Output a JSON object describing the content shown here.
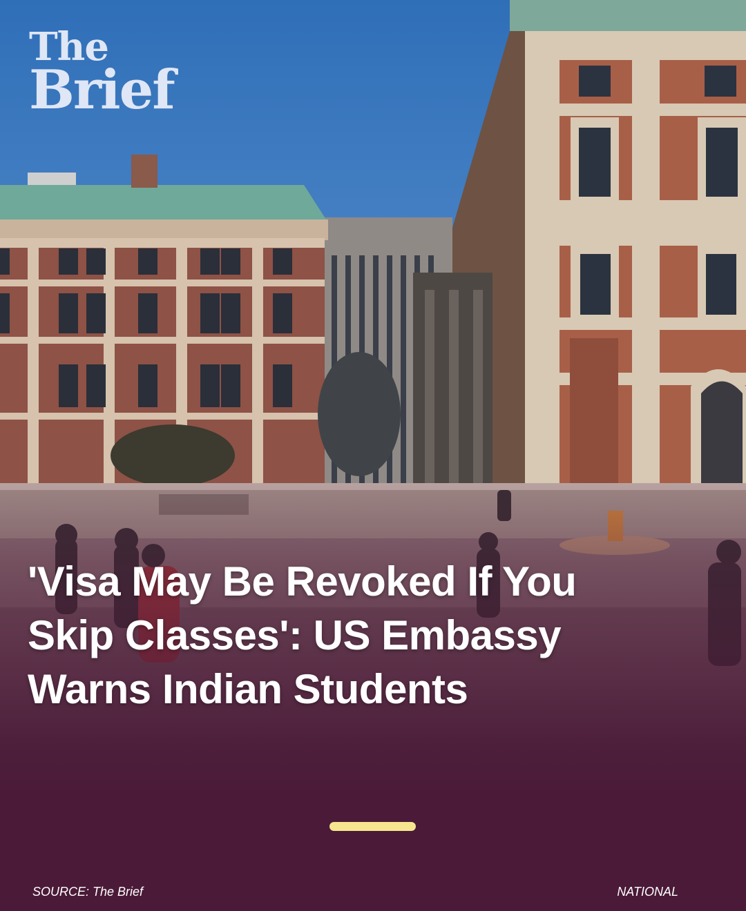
{
  "brand": {
    "line1": "The",
    "line2": "Brief"
  },
  "headline": "'Visa May Be Revoked If You Skip Classes': US Embassy Warns Indian Students",
  "footer": {
    "source": "SOURCE: The Brief",
    "category": "NATIONAL"
  },
  "colors": {
    "background": "#4a1a38",
    "accent_bar": "#f6e58f",
    "logo": "#dfe6f5",
    "text": "#ffffff"
  }
}
